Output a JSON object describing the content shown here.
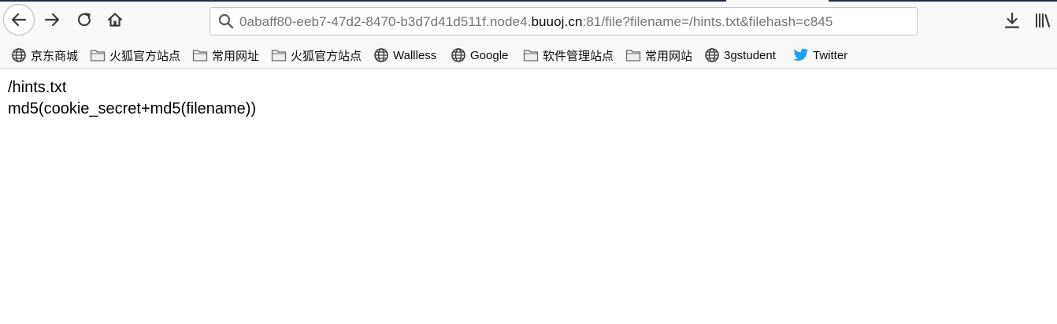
{
  "browser": {
    "url_prefix": "0abaff80-eeb7-47d2-8470-b3d7d41d511f.node4.",
    "url_host": "buuoj.cn",
    "url_suffix": ":81/file?filename=/hints.txt&filehash=c845"
  },
  "bookmarks": [
    {
      "label": "京东商城",
      "icon": "globe-icon"
    },
    {
      "label": "火狐官方站点",
      "icon": "folder-icon"
    },
    {
      "label": "常用网址",
      "icon": "folder-icon"
    },
    {
      "label": "火狐官方站点",
      "icon": "folder-icon"
    },
    {
      "label": "Wallless",
      "icon": "globe-icon"
    },
    {
      "label": "Google",
      "icon": "globe-icon"
    },
    {
      "label": "软件管理站点",
      "icon": "folder-icon"
    },
    {
      "label": "常用网站",
      "icon": "folder-icon"
    },
    {
      "label": "3gstudent",
      "icon": "globe-icon"
    },
    {
      "label": "Twitter",
      "icon": "twitter-icon"
    }
  ],
  "page": {
    "lines": [
      "/hints.txt",
      "md5(cookie_secret+md5(filename))"
    ]
  },
  "colors": {
    "toolbar_bg": "#f9f9fa",
    "twitter_blue": "#1da1f2"
  }
}
